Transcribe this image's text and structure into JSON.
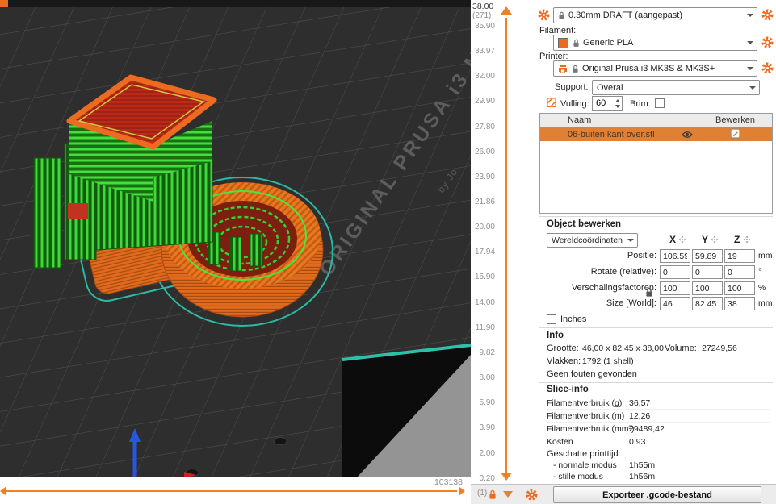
{
  "app": {
    "accent_color": "#ED6B21"
  },
  "viewport": {
    "bed_text_primary": "ORIGINAL PRUSA i3 M",
    "bed_text_secondary": "by Jo",
    "horizontal_slider_value": "103138"
  },
  "layer_slider": {
    "top_height": "38.00",
    "top_layer": "(271)",
    "bottom_layer": "(1)",
    "ticks": [
      "35.90",
      "33.97",
      "32.00",
      "29.90",
      "27.80",
      "26.00",
      "23.90",
      "21.86",
      "20.00",
      "17.94",
      "15.90",
      "14.00",
      "11.90",
      "9.82",
      "8.00",
      "5.90",
      "3.90",
      "2.00",
      "0.20"
    ]
  },
  "presets": {
    "print": "0.30mm DRAFT (aangepast)",
    "filament_label": "Filament:",
    "filament": "Generic PLA",
    "printer_label": "Printer:",
    "printer": "Original Prusa i3 MK3S & MK3S+"
  },
  "options": {
    "support_label": "Support:",
    "support_value": "Overal",
    "infill_label": "Vulling:",
    "infill_value": "60",
    "brim_label": "Brim:"
  },
  "object_table": {
    "col_name": "Naam",
    "col_edit": "Bewerken",
    "rows": [
      {
        "name": "06-buiten kant over.stl"
      }
    ]
  },
  "manipulation": {
    "title": "Object bewerken",
    "coord_system": "Wereldcoördinaten",
    "axes": [
      "X",
      "Y",
      "Z"
    ],
    "rows": [
      {
        "label": "Positie:",
        "x": "106.59",
        "y": "59.89",
        "z": "19",
        "unit": "mm"
      },
      {
        "label": "Rotate (relative):",
        "x": "0",
        "y": "0",
        "z": "0",
        "unit": "°"
      },
      {
        "label": "Verschalingsfactoren:",
        "x": "100",
        "y": "100",
        "z": "100",
        "unit": "%"
      },
      {
        "label": "Size [World]:",
        "x": "46",
        "y": "82.45",
        "z": "38",
        "unit": "mm"
      }
    ],
    "inches_label": "Inches"
  },
  "info": {
    "title": "Info",
    "size_label": "Grootte:",
    "size_value": "46,00 x 82,45 x 38,00",
    "volume_label": "Volume:",
    "volume_value": "27249,56",
    "facets_label": "Vlakken:",
    "facets_value": "1792 (1 shell)",
    "errors_text": "Geen fouten gevonden"
  },
  "slice_info": {
    "title": "Slice-info",
    "rows": [
      {
        "label": "Filamentverbruik (g)",
        "value": "36,57"
      },
      {
        "label": "Filamentverbruik (m)",
        "value": "12,26"
      },
      {
        "label": "Filamentverbruik (mm³)",
        "value": "29489,42"
      },
      {
        "label": "Kosten",
        "value": "0,93"
      }
    ],
    "time_title": "Geschatte printtijd:",
    "time_rows": [
      {
        "label": "- normale modus",
        "value": "1h55m"
      },
      {
        "label": "- stille modus",
        "value": "1h56m"
      }
    ]
  },
  "export": {
    "button_label": "Exporteer .gcode-bestand"
  }
}
